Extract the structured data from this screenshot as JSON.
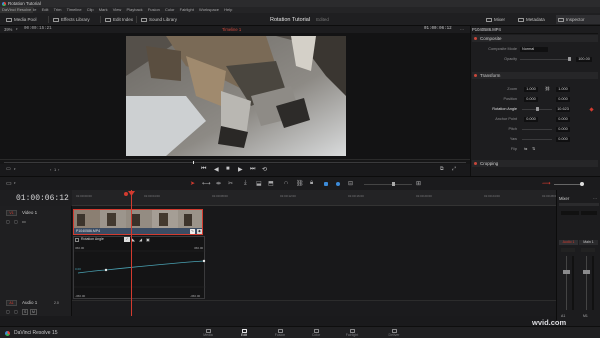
{
  "window": {
    "title": "Rotation Tutorial"
  },
  "menu": [
    "DaVinci Resolve",
    "File",
    "Edit",
    "Trim",
    "Timeline",
    "Clip",
    "Mark",
    "View",
    "Playback",
    "Fusion",
    "Color",
    "Fairlight",
    "Workspace",
    "Help"
  ],
  "toolbar": {
    "left": [
      "Media Pool",
      "Effects Library",
      "Edit Index",
      "Sound Library"
    ],
    "project_title": "Rotation Tutorial",
    "project_status": "Edited",
    "right": [
      "Mixer",
      "Metadata",
      "Inspector"
    ]
  },
  "viewer": {
    "zoom": "39%",
    "source_tc": "00:00:15:21",
    "timeline_name": "Timeline 1",
    "record_tc": "01:00:06:12",
    "page_label": "1"
  },
  "inspector": {
    "clip_name": "P1040586.MP4",
    "composite": {
      "title": "Composite",
      "mode_label": "Composite Mode",
      "mode_value": "Normal",
      "opacity_label": "Opacity",
      "opacity_value": "100.00"
    },
    "transform": {
      "title": "Transform",
      "zoom_label": "Zoom",
      "zoom_x": "1.000",
      "zoom_y": "1.000",
      "position_label": "Position",
      "position_x": "0.000",
      "position_y": "0.000",
      "rotation_label": "Rotation Angle",
      "rotation_value": "10.623",
      "anchor_label": "Anchor Point",
      "anchor_x": "0.000",
      "anchor_y": "0.000",
      "pitch_label": "Pitch",
      "pitch_value": "0.000",
      "yaw_label": "Yaw",
      "yaw_value": "0.000",
      "flip_label": "Flip"
    },
    "cropping": {
      "title": "Cropping"
    }
  },
  "timeline": {
    "timecode": "01:00:06:12",
    "ruler_ticks": [
      "01:00:00:00",
      "01:00:04:00",
      "01:00:08:00",
      "01:00:12:00",
      "01:00:16:00",
      "01:00:20:00",
      "01:00:24:00",
      "01:00:28:00"
    ],
    "video_track": {
      "name": "Video 1",
      "id": "V1"
    },
    "audio_track": {
      "name": "Audio 1",
      "id": "A1",
      "level": "2.0"
    },
    "clip_name": "P1040586.MP4",
    "curve_label": "Rotation Angle",
    "curve_top_value": "360.00",
    "curve_bottom_value": "-360.00",
    "curve_keyframe": "0.00"
  },
  "mixer": {
    "title": "Mixer",
    "channels": [
      "A1",
      "M1"
    ],
    "channel_labels": [
      "Audio 1",
      "Main 1"
    ]
  },
  "pages": [
    "Media",
    "Edit",
    "Fusion",
    "Color",
    "Fairlight",
    "Deliver"
  ],
  "active_page": "Edit",
  "app_brand": "DaVinci Resolve 15",
  "watermark": "wvid.com",
  "colors": {
    "accent_red": "#d33b2f",
    "clip_blue": "#3b4c63",
    "curve_teal": "#4aa3b4"
  }
}
